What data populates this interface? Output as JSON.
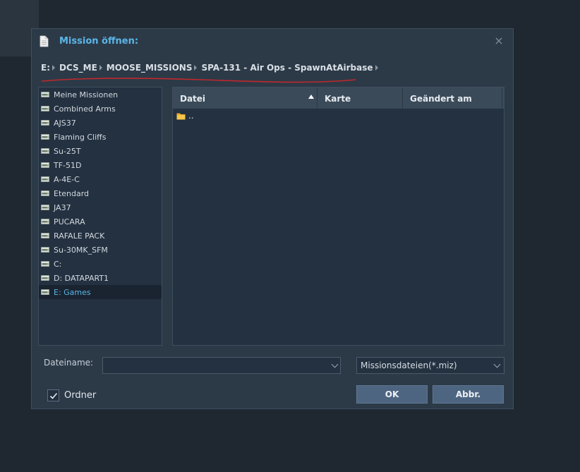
{
  "dialog": {
    "title": "Mission öffnen:",
    "close_label": "×"
  },
  "breadcrumb": [
    "E:",
    "DCS_ME",
    "MOOSE_MISSIONS",
    "SPA-131 - Air Ops - SpawnAtAirbase"
  ],
  "sidebar": {
    "items": [
      {
        "label": "Meine Missionen",
        "selected": false
      },
      {
        "label": "Combined Arms",
        "selected": false
      },
      {
        "label": "AJS37",
        "selected": false
      },
      {
        "label": "Flaming Cliffs",
        "selected": false
      },
      {
        "label": "Su-25T",
        "selected": false
      },
      {
        "label": "TF-51D",
        "selected": false
      },
      {
        "label": "A-4E-C",
        "selected": false
      },
      {
        "label": "Etendard",
        "selected": false
      },
      {
        "label": "JA37",
        "selected": false
      },
      {
        "label": "PUCARA",
        "selected": false
      },
      {
        "label": "RAFALE PACK",
        "selected": false
      },
      {
        "label": "Su-30MK_SFM",
        "selected": false
      },
      {
        "label": "C:",
        "selected": false
      },
      {
        "label": "D: DATAPART1",
        "selected": false
      },
      {
        "label": "E: Games",
        "selected": true
      }
    ]
  },
  "files": {
    "columns": [
      "Datei",
      "Karte",
      "Geändert am"
    ],
    "sort_column": "Datei",
    "rows": [
      {
        "name": ".."
      }
    ]
  },
  "footer": {
    "filename_label": "Dateiname:",
    "filename_value": "",
    "filter_value": "Missionsdateien(*.miz)",
    "folder_checkbox_label": "Ordner",
    "folder_checked": true,
    "ok_label": "OK",
    "cancel_label": "Abbr."
  },
  "colors": {
    "accent": "#5bb6e8",
    "annotation": "#c0282b"
  }
}
